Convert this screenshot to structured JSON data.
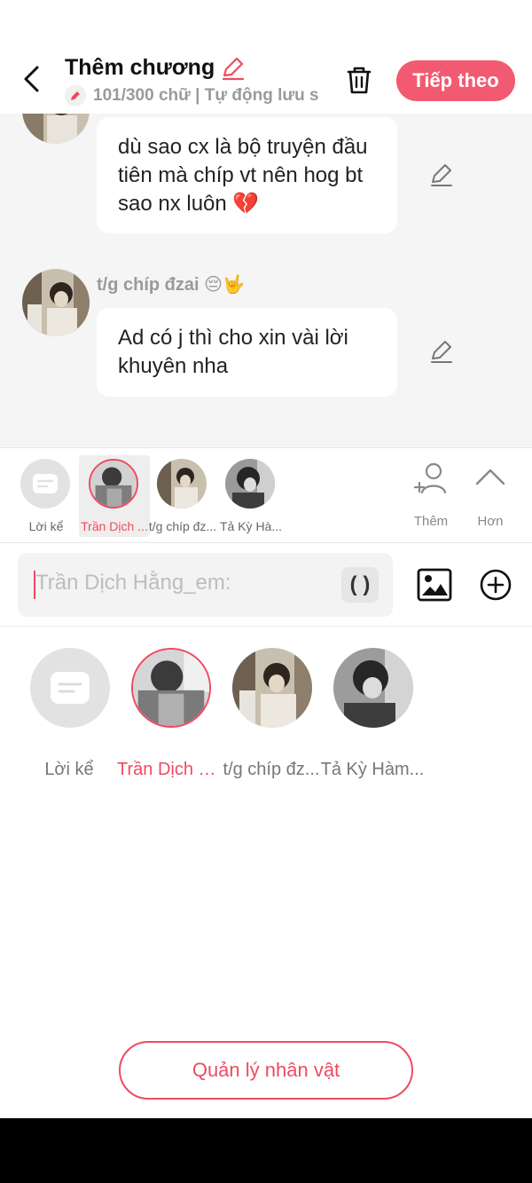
{
  "header": {
    "title": "Thêm chương",
    "subtitle": "101/300 chữ | Tự động lưu s",
    "next_label": "Tiếp theo"
  },
  "messages": [
    {
      "sender": "",
      "text": "dù sao cx là bộ truyện đầu tiên mà chíp vt nên hog bt sao nx luôn 💔"
    },
    {
      "sender": "t/g chíp đzai 😔🤟",
      "text": "Ad có j thì cho xin vài lời khuyên nha"
    }
  ],
  "character_strip": {
    "items": [
      {
        "label": "Lời kể"
      },
      {
        "label": "Trần Dịch ..."
      },
      {
        "label": "t/g chíp đz..."
      },
      {
        "label": "Tả Kỳ Hà..."
      }
    ],
    "add_label": "Thêm",
    "more_label": "Hơn"
  },
  "input": {
    "placeholder": "Trần Dịch Hằng_em:",
    "paren_label": "( )"
  },
  "character_panel": {
    "items": [
      {
        "label": "Lời kể"
      },
      {
        "label": "Trần Dịch H..."
      },
      {
        "label": "t/g chíp đz..."
      },
      {
        "label": "Tả Kỳ Hàm..."
      }
    ],
    "manage_label": "Quản lý nhân vật"
  },
  "colors": {
    "accent": "#f25a72",
    "chat_bg": "#f5f5f5"
  }
}
